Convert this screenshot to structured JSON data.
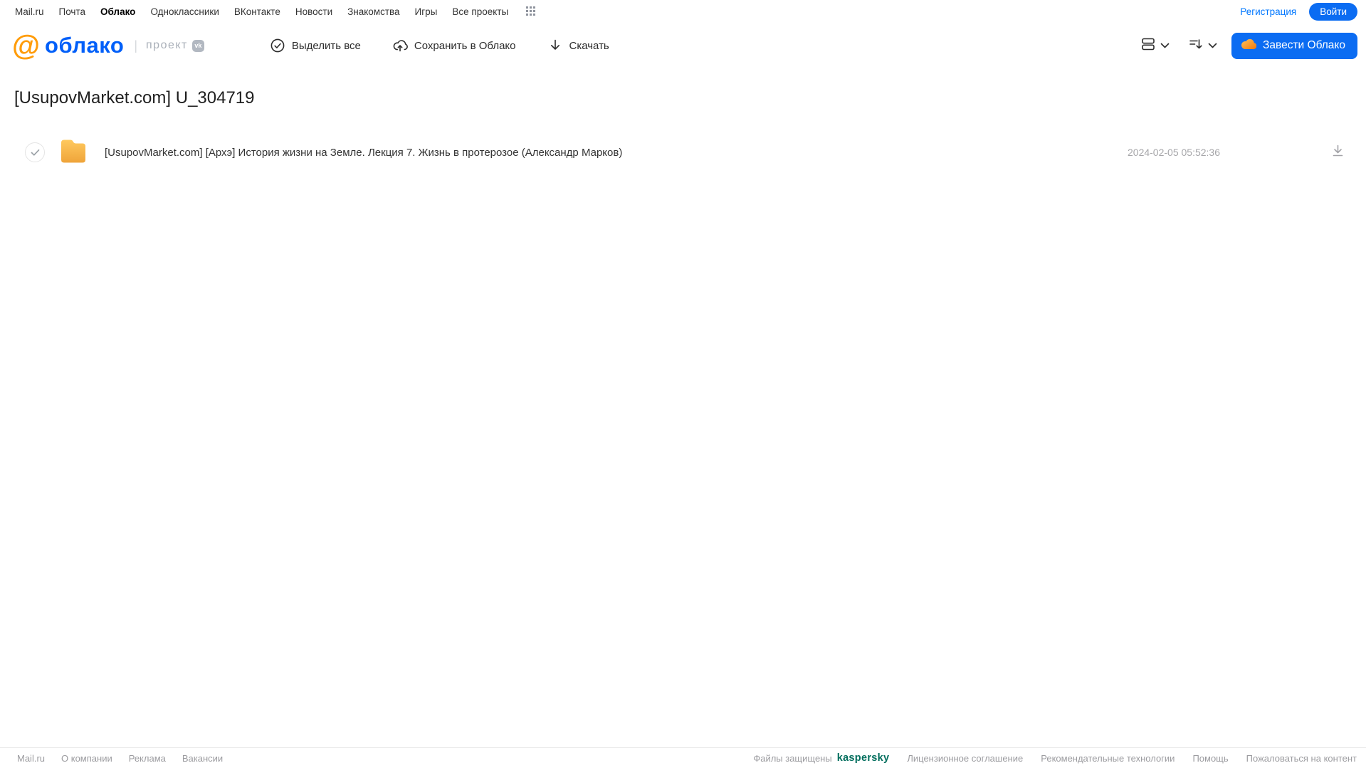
{
  "topnav": {
    "items": [
      "Mail.ru",
      "Почта",
      "Облако",
      "Одноклассники",
      "ВКонтакте",
      "Новости",
      "Знакомства",
      "Игры",
      "Все проекты"
    ],
    "registration": "Регистрация",
    "login": "Войти"
  },
  "header": {
    "logo_at": "@",
    "logo_text": "облако",
    "logo_project": "проект",
    "logo_vk": "vk",
    "toolbar": {
      "select_all": "Выделить все",
      "save_to_cloud": "Сохранить в Облако",
      "download": "Скачать"
    },
    "cta": "Завести Облако"
  },
  "page": {
    "title": "[UsupovMarket.com] U_304719"
  },
  "files": [
    {
      "name": "[UsupovMarket.com] [Архэ] История жизни на Земле. Лекция 7. Жизнь в протерозое (Александр Марков)",
      "date": "2024-02-05 05:52:36"
    }
  ],
  "footer": {
    "links_left": [
      "Mail.ru",
      "О компании",
      "Реклама",
      "Вакансии"
    ],
    "protected_by": "Файлы защищены",
    "kaspersky": "kaspersky",
    "links_right": [
      "Лицензионное соглашение",
      "Рекомендательные технологии",
      "Помощь",
      "Пожаловаться на контент"
    ]
  },
  "colors": {
    "accent_blue": "#0b6cf2",
    "link_blue": "#0077FF",
    "logo_blue": "#005FF9",
    "logo_orange": "#ff9c09",
    "folder_amber": "#f6b73c",
    "kaspersky_green": "#006d5c",
    "muted_gray": "#9b9b9f"
  }
}
